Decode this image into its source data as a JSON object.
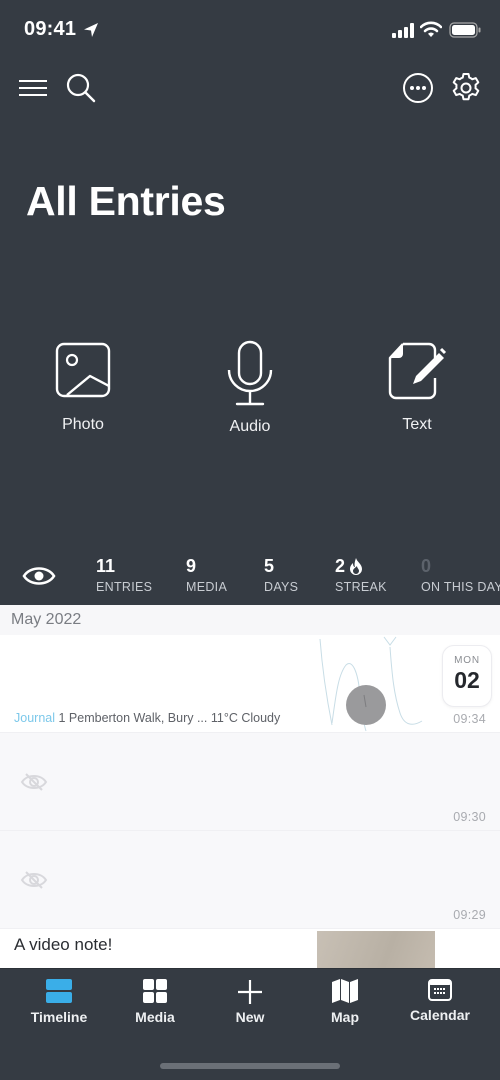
{
  "status_bar": {
    "time": "09:41",
    "icons": [
      "location-arrow-icon",
      "cellular-signal-icon",
      "wifi-icon",
      "battery-icon"
    ]
  },
  "top_bar": {
    "icons": [
      "hamburger-menu-icon",
      "search-icon",
      "more-options-icon",
      "settings-gear-icon"
    ]
  },
  "header": {
    "title": "All Entries"
  },
  "quick_actions": [
    {
      "label": "Photo",
      "icon": "photo-icon"
    },
    {
      "label": "Audio",
      "icon": "microphone-icon"
    },
    {
      "label": "Text",
      "icon": "document-edit-icon"
    }
  ],
  "stats": {
    "visibility_icon": "eye-icon",
    "items": [
      {
        "value": "11",
        "label": "ENTRIES"
      },
      {
        "value": "9",
        "label": "MEDIA"
      },
      {
        "value": "5",
        "label": "DAYS"
      },
      {
        "value": "2",
        "label": "STREAK",
        "icon": "flame-icon"
      },
      {
        "value": "0",
        "label": "ON THIS DAY"
      }
    ]
  },
  "timeline": {
    "month": "May 2022",
    "entries": [
      {
        "journal": "Journal",
        "location": "1 Pemberton Walk, Bury ...",
        "weather": "11°C Cloudy",
        "date_dow": "MON",
        "date_day": "02",
        "time": "09:34",
        "thumbnail": "sketch-drawing"
      },
      {
        "hidden": true,
        "time": "09:30",
        "icon": "eye-slash-icon"
      },
      {
        "hidden": true,
        "time": "09:29",
        "icon": "eye-slash-icon"
      },
      {
        "title": "A video note!",
        "thumbnail": "video-thumbnail"
      }
    ]
  },
  "tab_bar": {
    "active": "Timeline",
    "active_color": "#3aaee8",
    "tabs": [
      {
        "label": "Timeline",
        "icon": "timeline-icon"
      },
      {
        "label": "Media",
        "icon": "media-grid-icon"
      },
      {
        "label": "New",
        "icon": "plus-icon"
      },
      {
        "label": "Map",
        "icon": "map-icon"
      },
      {
        "label": "Calendar",
        "icon": "calendar-icon"
      }
    ]
  },
  "colors": {
    "background": "#353b43",
    "accent": "#3aaee8",
    "journal_label": "#7cc8ea"
  }
}
